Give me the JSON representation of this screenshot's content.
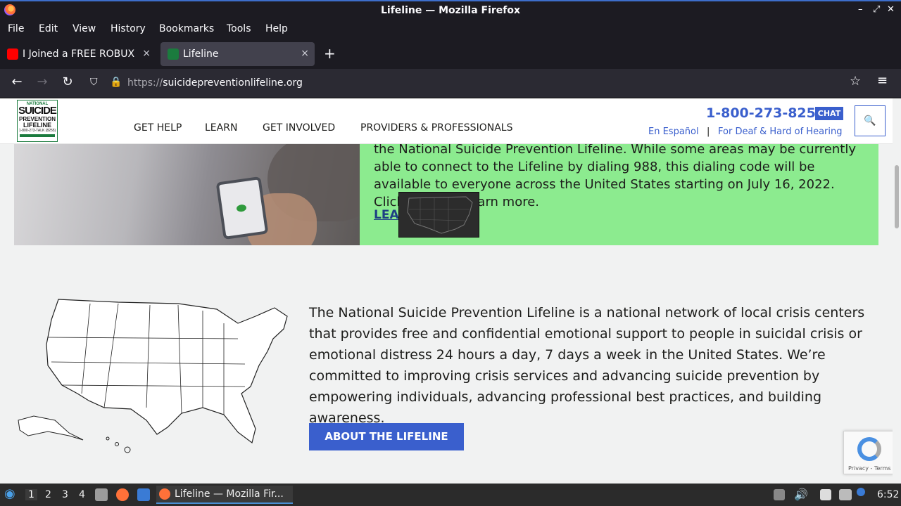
{
  "window": {
    "title": "Lifeline — Mozilla Firefox",
    "controls": [
      "–",
      "⤢",
      "✕"
    ]
  },
  "menu": [
    "File",
    "Edit",
    "View",
    "History",
    "Bookmarks",
    "Tools",
    "Help"
  ],
  "tabs": [
    {
      "label": "I Joined a FREE ROBUX G",
      "favicon_color": "#ff0000",
      "close": "×"
    },
    {
      "label": "Lifeline",
      "favicon_color": "#1b7b3e",
      "close": "×"
    }
  ],
  "newtab": "+",
  "nav": {
    "back": "←",
    "forward": "→",
    "reload": "↻",
    "star": "☆",
    "menu": "≡"
  },
  "url": {
    "protocol": "https://",
    "host": "suicidepreventionlifeline.org"
  },
  "site": {
    "logo": {
      "line1": "NATIONAL",
      "line2": "SUICIDE",
      "line3": "PREVENTION",
      "line4": "LIFELINE",
      "line5": "1-800-273-TALK (8255)"
    },
    "nav": [
      "GET HELP",
      "LEARN",
      "GET INVOLVED",
      "PROVIDERS & PROFESSIONALS"
    ],
    "phone": "1-800-273-8255",
    "chat": "CHAT",
    "links": [
      "En Español",
      "|",
      "For Deaf & Hard of Hearing"
    ],
    "search_icon": "🔍"
  },
  "banner": {
    "text": "the National Suicide Prevention Lifeline. While some areas may be currently able to connect to the Lifeline by dialing 988, this dialing code will be available to everyone across the United States starting on July 16, 2022. Click below to learn more.",
    "link": "LEA"
  },
  "about": {
    "text": "The National Suicide Prevention Lifeline is a national network of local crisis centers that provides free and confidential emotional support to people in suicidal crisis or emotional distress 24 hours a day, 7 days a week in the United States. We’re committed to improving crisis services and advancing suicide prevention by empowering individuals, advancing professional best practices, and building awareness.",
    "button": "ABOUT THE LIFELINE"
  },
  "recaptcha": {
    "text": "Privacy - Terms"
  },
  "taskbar": {
    "workspaces": [
      "1",
      "2",
      "3",
      "4"
    ],
    "active_window": "Lifeline — Mozilla Fir...",
    "clock": "6:52"
  }
}
